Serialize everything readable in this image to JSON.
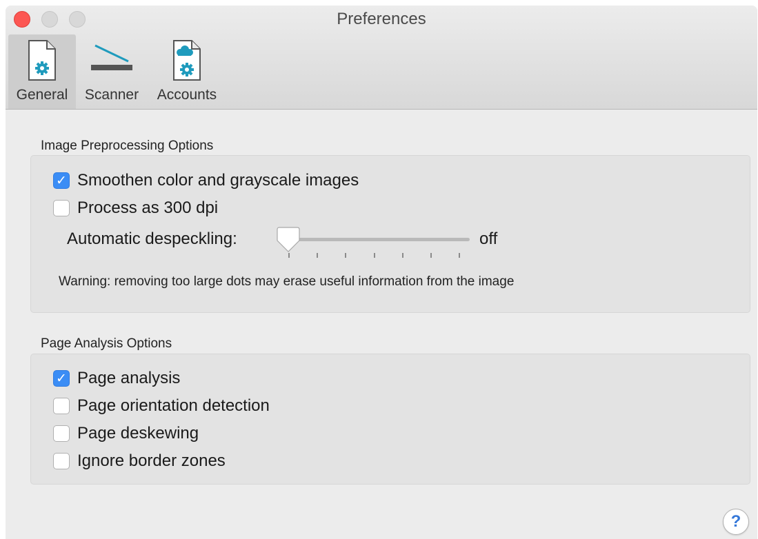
{
  "window": {
    "title": "Preferences"
  },
  "tabs": [
    {
      "label": "General",
      "icon": "document-gear-icon",
      "active": true
    },
    {
      "label": "Scanner",
      "icon": "scanner-icon",
      "active": false
    },
    {
      "label": "Accounts",
      "icon": "cloud-document-gear-icon",
      "active": false
    }
  ],
  "image_preprocessing": {
    "title": "Image Preprocessing Options",
    "options": [
      {
        "label": "Smoothen color and grayscale images",
        "checked": true
      },
      {
        "label": "Process as 300 dpi",
        "checked": false
      }
    ],
    "despeckle": {
      "label": "Automatic despeckling:",
      "value_text": "off",
      "level": 0,
      "steps": 7
    },
    "warning": "Warning: removing too large dots may erase useful information from the image"
  },
  "page_analysis": {
    "title": "Page Analysis Options",
    "options": [
      {
        "label": "Page analysis",
        "checked": true
      },
      {
        "label": "Page orientation detection",
        "checked": false
      },
      {
        "label": "Page deskewing",
        "checked": false
      },
      {
        "label": "Ignore border zones",
        "checked": false
      }
    ]
  },
  "help": {
    "symbol": "?"
  },
  "colors": {
    "accent": "#3b8df5",
    "icon_teal": "#1f9bbd",
    "close_button": "#fc5753"
  }
}
